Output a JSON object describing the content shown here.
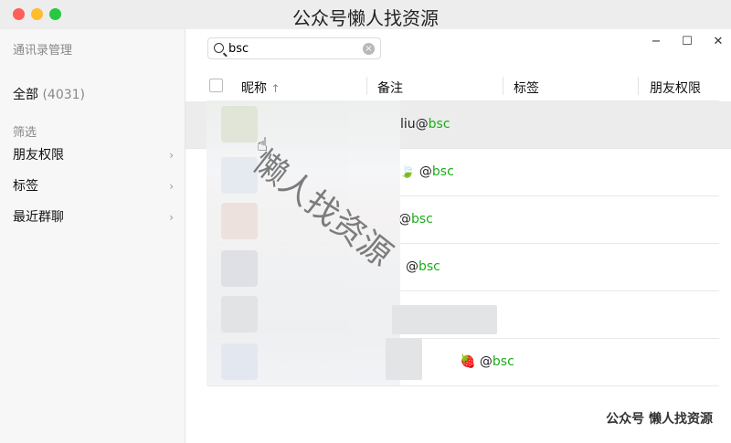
{
  "window": {
    "title_overlay": "公众号懒人找资源"
  },
  "sidebar": {
    "title": "通讯录管理",
    "all_label": "全部",
    "all_count": "(4031)",
    "filter_label": "筛选",
    "items": [
      {
        "label": "朋友权限"
      },
      {
        "label": "标签"
      },
      {
        "label": "最近群聊"
      }
    ]
  },
  "search": {
    "value": "bsc",
    "clear": "×"
  },
  "window_controls": {
    "minimize": "−",
    "maximize": "☐",
    "close": "✕"
  },
  "table": {
    "columns": {
      "nickname": "昵称",
      "remark": "备注",
      "tags": "标签",
      "permissions": "朋友权限"
    },
    "sort_indicator": "↑",
    "rows": [
      {
        "remark_prefix": "liu@",
        "remark_tag": "bsc",
        "highlighted": true
      },
      {
        "remark_prefix": "🍃 @",
        "remark_tag": "bsc"
      },
      {
        "remark_prefix": "@",
        "remark_tag": "bsc"
      },
      {
        "remark_prefix": "@",
        "remark_tag": "bsc"
      },
      {
        "remark_prefix": "",
        "remark_tag": ""
      },
      {
        "remark_prefix": "🍓 @",
        "remark_tag": "bsc"
      }
    ]
  },
  "watermark": {
    "diagonal_text": "懒人找资源",
    "bottom_text": "公众号 懒人找资源"
  },
  "colors": {
    "accent_green": "#1aad19"
  }
}
